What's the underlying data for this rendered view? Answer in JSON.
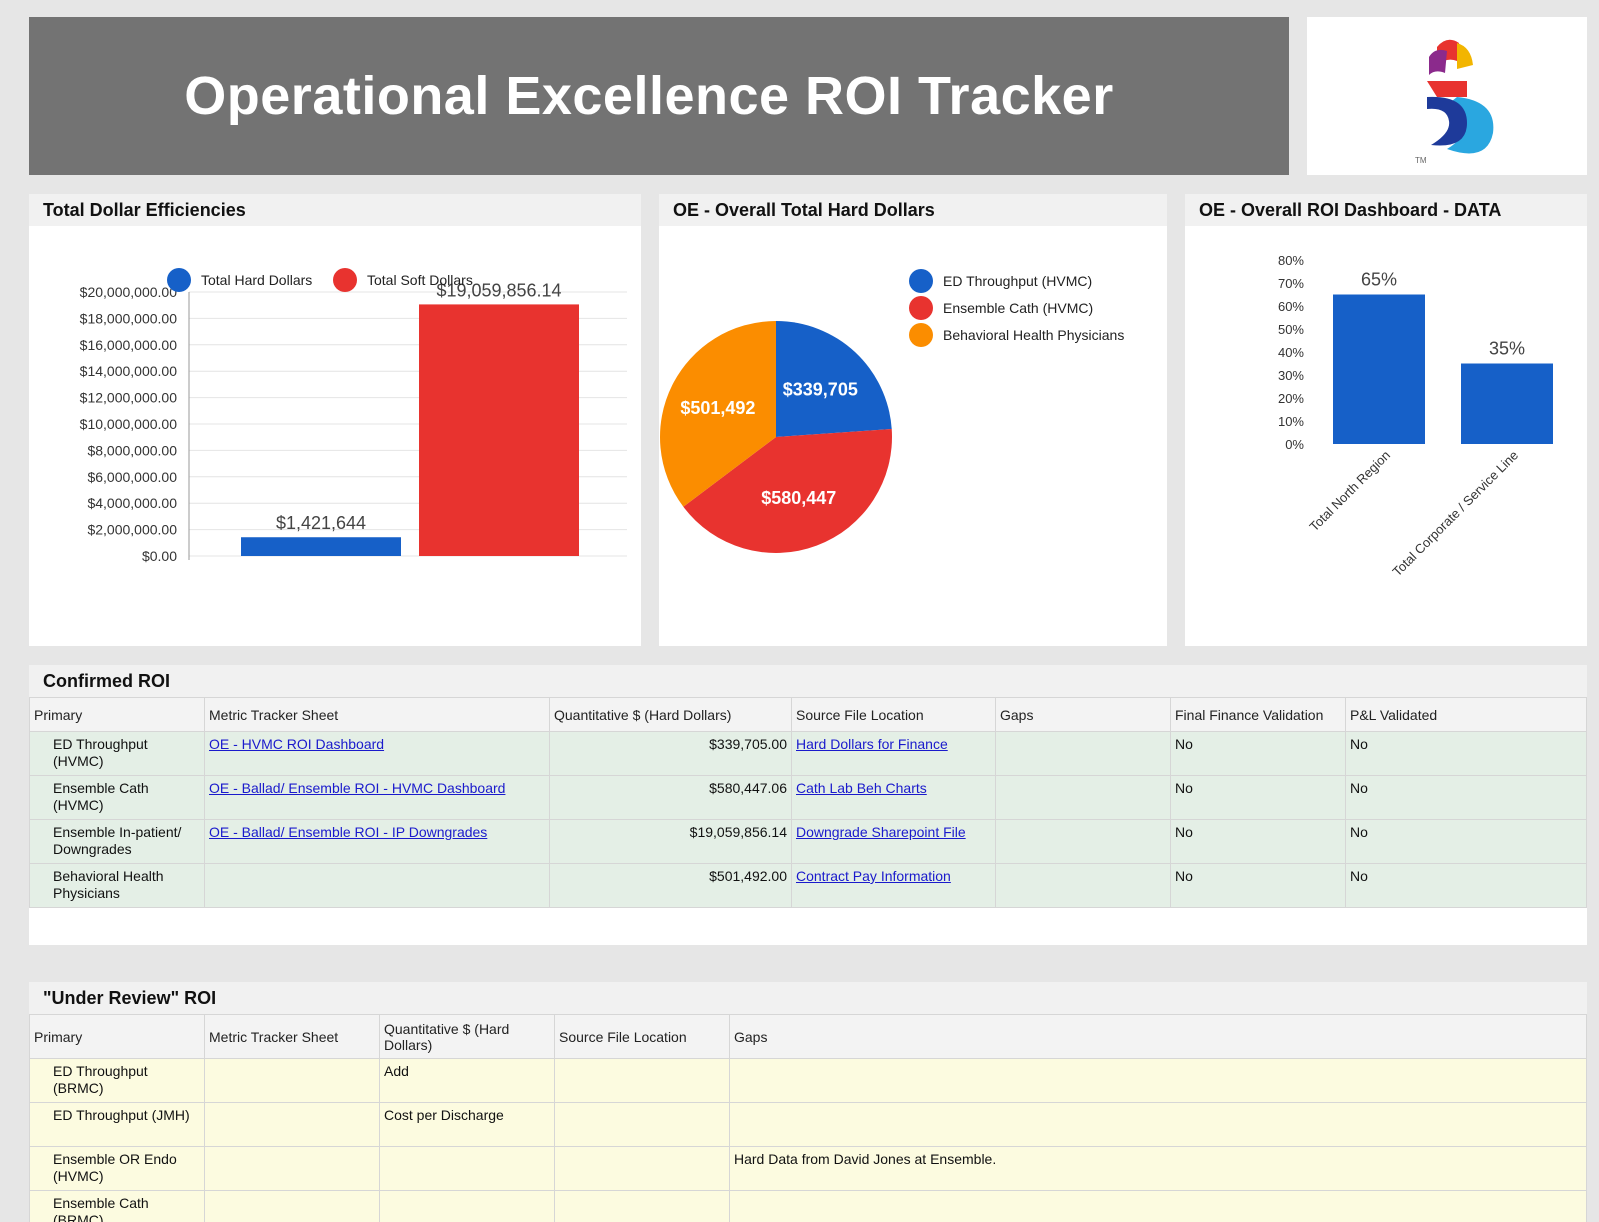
{
  "header": {
    "title": "Operational Excellence ROI Tracker",
    "logo_mark": "TM"
  },
  "colors": {
    "blue": "#1660c8",
    "red": "#e8332f",
    "orange": "#fb8d00",
    "bar_blue": "#1660c8"
  },
  "panels": {
    "total_dollar": "Total Dollar Efficiencies",
    "hard_dollars": "OE - Overall Total Hard Dollars",
    "roi_dashboard": "OE - Overall ROI Dashboard - DATA"
  },
  "chart_data": [
    {
      "type": "bar",
      "title": "Total Dollar Efficiencies",
      "series": [
        {
          "name": "Total Hard Dollars",
          "values": [
            1421644
          ],
          "label": "$1,421,644"
        },
        {
          "name": "Total Soft Dollars",
          "values": [
            19059856.14
          ],
          "label": "$19,059,856.14"
        }
      ],
      "ylim": [
        0,
        20000000
      ],
      "yticks": [
        "$0.00",
        "$2,000,000.00",
        "$4,000,000.00",
        "$6,000,000.00",
        "$8,000,000.00",
        "$10,000,000.00",
        "$12,000,000.00",
        "$14,000,000.00",
        "$16,000,000.00",
        "$18,000,000.00",
        "$20,000,000.00"
      ],
      "grid": true,
      "legend": "top"
    },
    {
      "type": "pie",
      "title": "OE - Overall Total Hard Dollars",
      "slices": [
        {
          "name": "ED Throughput (HVMC)",
          "value": 339705,
          "label": "$339,705"
        },
        {
          "name": "Ensemble Cath (HVMC)",
          "value": 580447,
          "label": "$580,447"
        },
        {
          "name": "Behavioral Health Physicians",
          "value": 501492,
          "label": "$501,492"
        }
      ],
      "legend": "top-right"
    },
    {
      "type": "bar",
      "title": "OE - Overall ROI Dashboard - DATA",
      "categories": [
        "Total North Region",
        "Total Corporate / Service Line"
      ],
      "values": [
        65,
        35
      ],
      "labels": [
        "65%",
        "35%"
      ],
      "ylim": [
        0,
        80
      ],
      "yticks": [
        "0%",
        "10%",
        "20%",
        "30%",
        "40%",
        "50%",
        "60%",
        "70%",
        "80%"
      ],
      "grid": false
    }
  ],
  "confirmed": {
    "title": "Confirmed ROI",
    "headers": [
      "Primary",
      "Metric Tracker Sheet",
      "Quantitative $ (Hard Dollars)",
      "Source File Location",
      "Gaps",
      "Final Finance Validation",
      "P&L Validated"
    ],
    "rows": [
      {
        "primary": "ED Throughput (HVMC)",
        "sheet": "OE - HVMC ROI Dashboard",
        "amount": "$339,705.00",
        "source": "Hard Dollars for Finance",
        "gaps": "",
        "finance": "No",
        "pl": "No"
      },
      {
        "primary": "Ensemble Cath (HVMC)",
        "sheet": "OE - Ballad/ Ensemble ROI - HVMC Dashboard",
        "amount": "$580,447.06",
        "source": "Cath Lab Beh Charts",
        "gaps": "",
        "finance": "No",
        "pl": "No"
      },
      {
        "primary": "Ensemble In-patient/ Downgrades",
        "sheet": "OE - Ballad/ Ensemble ROI - IP Downgrades",
        "amount": "$19,059,856.14",
        "source": "Downgrade Sharepoint File",
        "gaps": "",
        "finance": "No",
        "pl": "No"
      },
      {
        "primary": "Behavioral Health Physicians",
        "sheet": "",
        "amount": "$501,492.00",
        "source": "Contract Pay Information",
        "gaps": "",
        "finance": "No",
        "pl": "No"
      }
    ]
  },
  "review": {
    "title": "\"Under Review\" ROI",
    "headers": [
      "Primary",
      "Metric Tracker Sheet",
      "Quantitative $ (Hard Dollars)",
      "Source File Location",
      "Gaps"
    ],
    "rows": [
      {
        "primary": "ED Throughput (BRMC)",
        "sheet": "",
        "amount": "Add",
        "source": "",
        "gaps": ""
      },
      {
        "primary": "ED Throughput (JMH)",
        "sheet": "",
        "amount": "Cost per Discharge",
        "source": "",
        "gaps": ""
      },
      {
        "primary": "Ensemble OR Endo (HVMC)",
        "sheet": "",
        "amount": "",
        "source": "",
        "gaps": "Hard Data from David Jones at Ensemble."
      },
      {
        "primary": "Ensemble Cath (BRMC)",
        "sheet": "",
        "amount": "",
        "source": "",
        "gaps": ""
      }
    ]
  }
}
